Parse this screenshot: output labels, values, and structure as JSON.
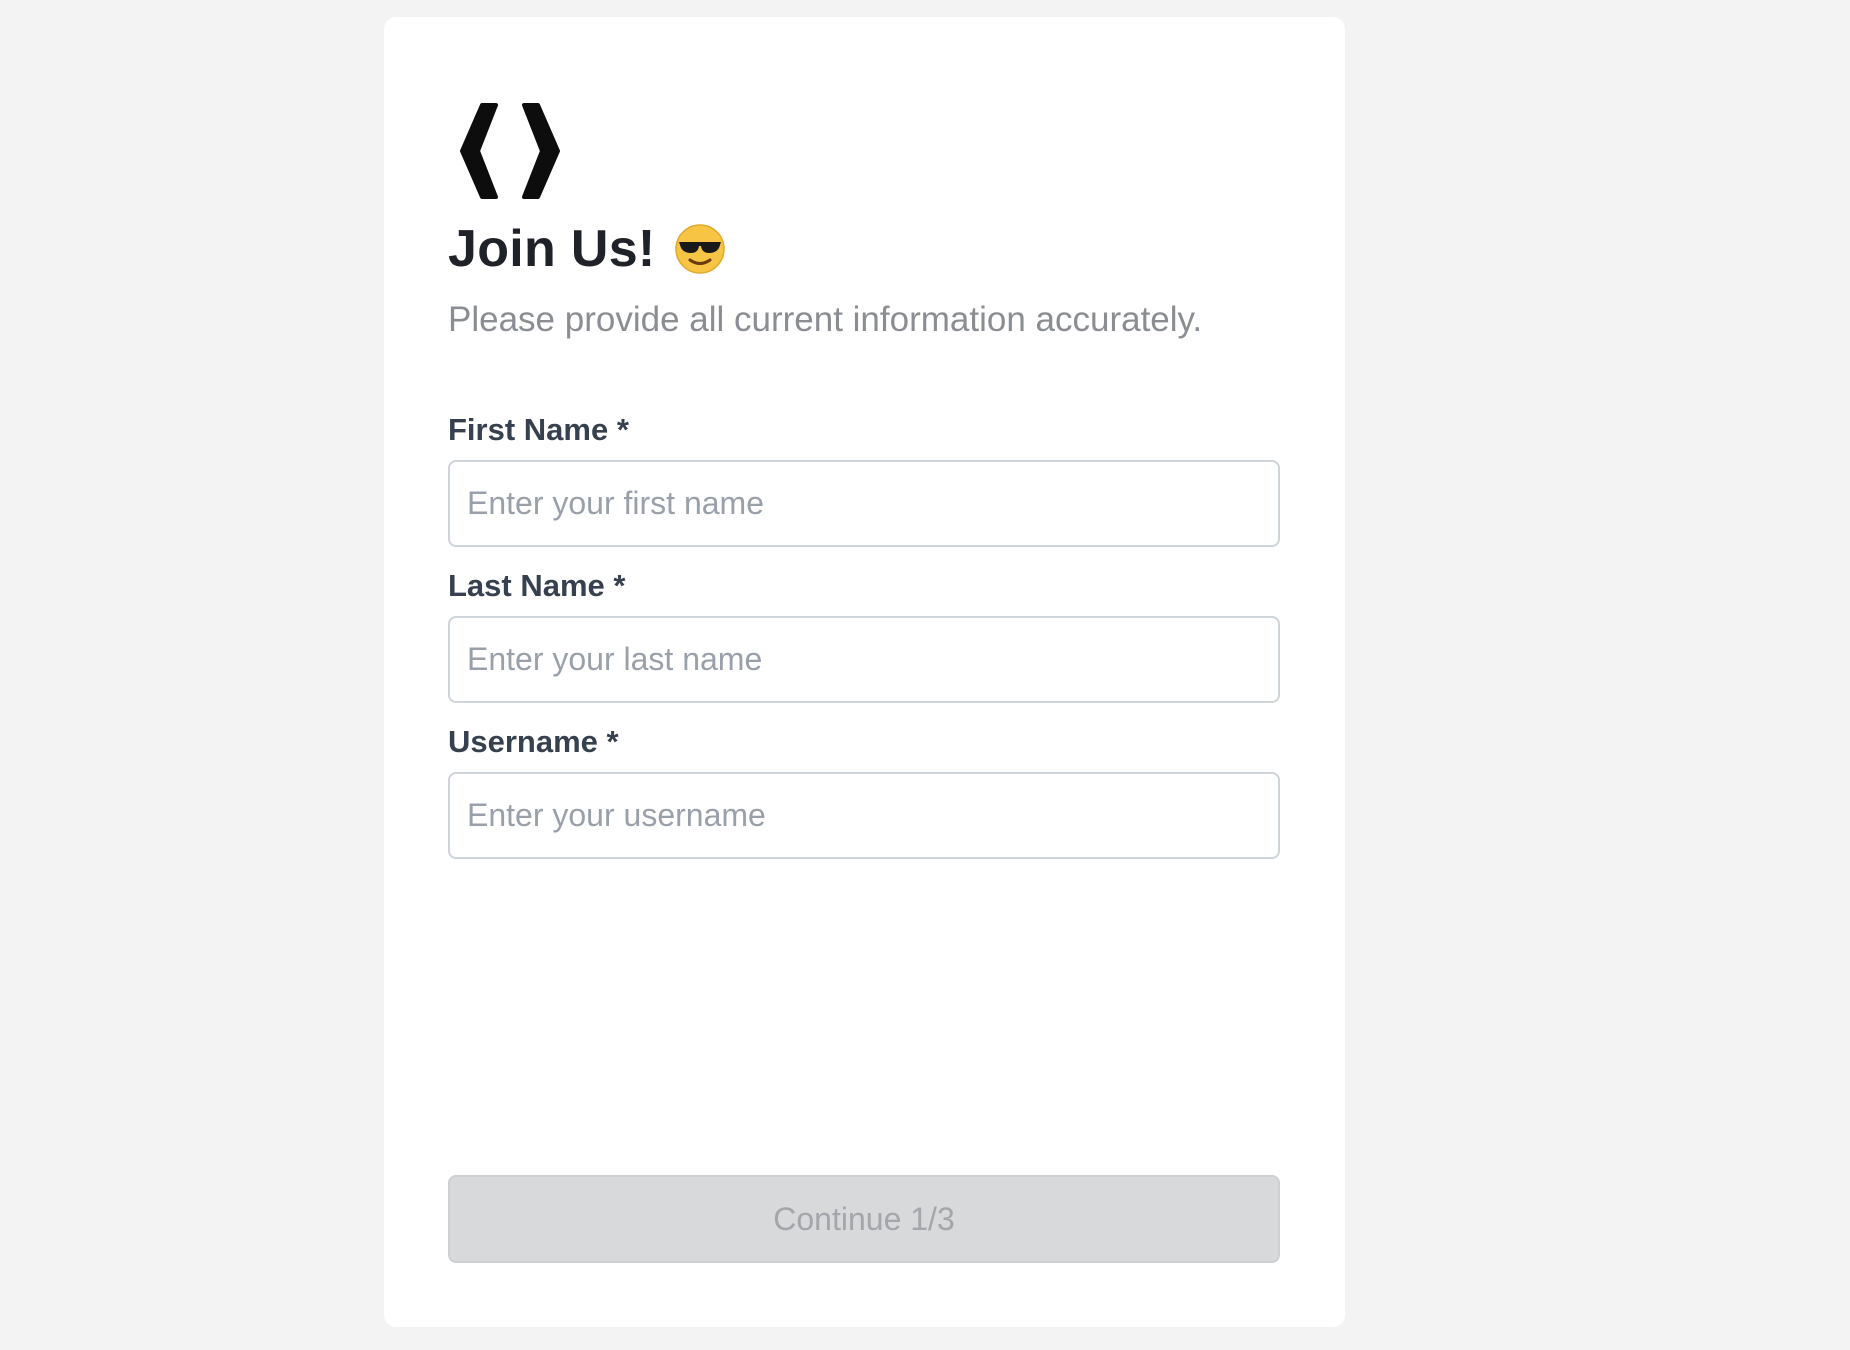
{
  "header": {
    "logo_icon": "code-brackets-icon",
    "title": "Join Us!",
    "title_emoji_icon": "sunglasses-emoji-icon",
    "subtitle": "Please provide all current information accurately."
  },
  "form": {
    "fields": [
      {
        "label": "First Name *",
        "placeholder": "Enter your first name",
        "value": ""
      },
      {
        "label": "Last Name *",
        "placeholder": "Enter your last name",
        "value": ""
      },
      {
        "label": "Username *",
        "placeholder": "Enter your username",
        "value": ""
      }
    ],
    "submit": {
      "label": "Continue 1/3",
      "disabled": true
    }
  },
  "colors": {
    "page_background": "#f3f3f3",
    "card_background": "#ffffff",
    "title": "#1f2329",
    "subtitle": "#8a8d91",
    "label": "#36404f",
    "placeholder": "#9aa0aa",
    "disabled_button_bg": "#d8d9da",
    "disabled_button_text": "#a3a6aa"
  }
}
